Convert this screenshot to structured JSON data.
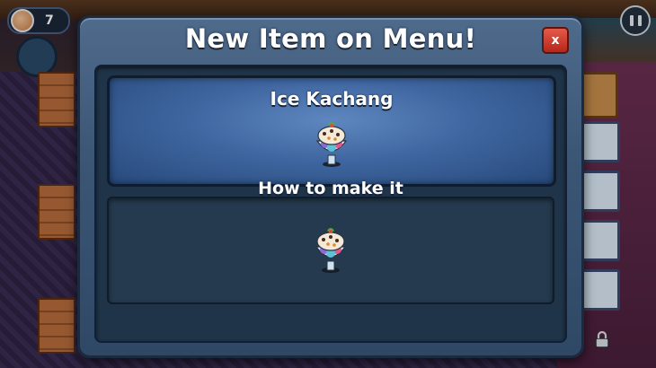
{
  "hud": {
    "avatar_icon": "chef-avatar-icon",
    "count": "7",
    "pause_icon": "pause-icon"
  },
  "modal": {
    "title": "New Item on Menu!",
    "close_label": "x",
    "item": {
      "name": "Ice Kachang",
      "image_icon": "ice-kachang-dessert-icon"
    },
    "howto": {
      "label": "How to make it",
      "image_icon": "ice-kachang-dessert-icon"
    }
  },
  "colors": {
    "modal_frame": "#3c5676",
    "highlight_panel": "#3f66a0",
    "close_button": "#c7342a"
  }
}
